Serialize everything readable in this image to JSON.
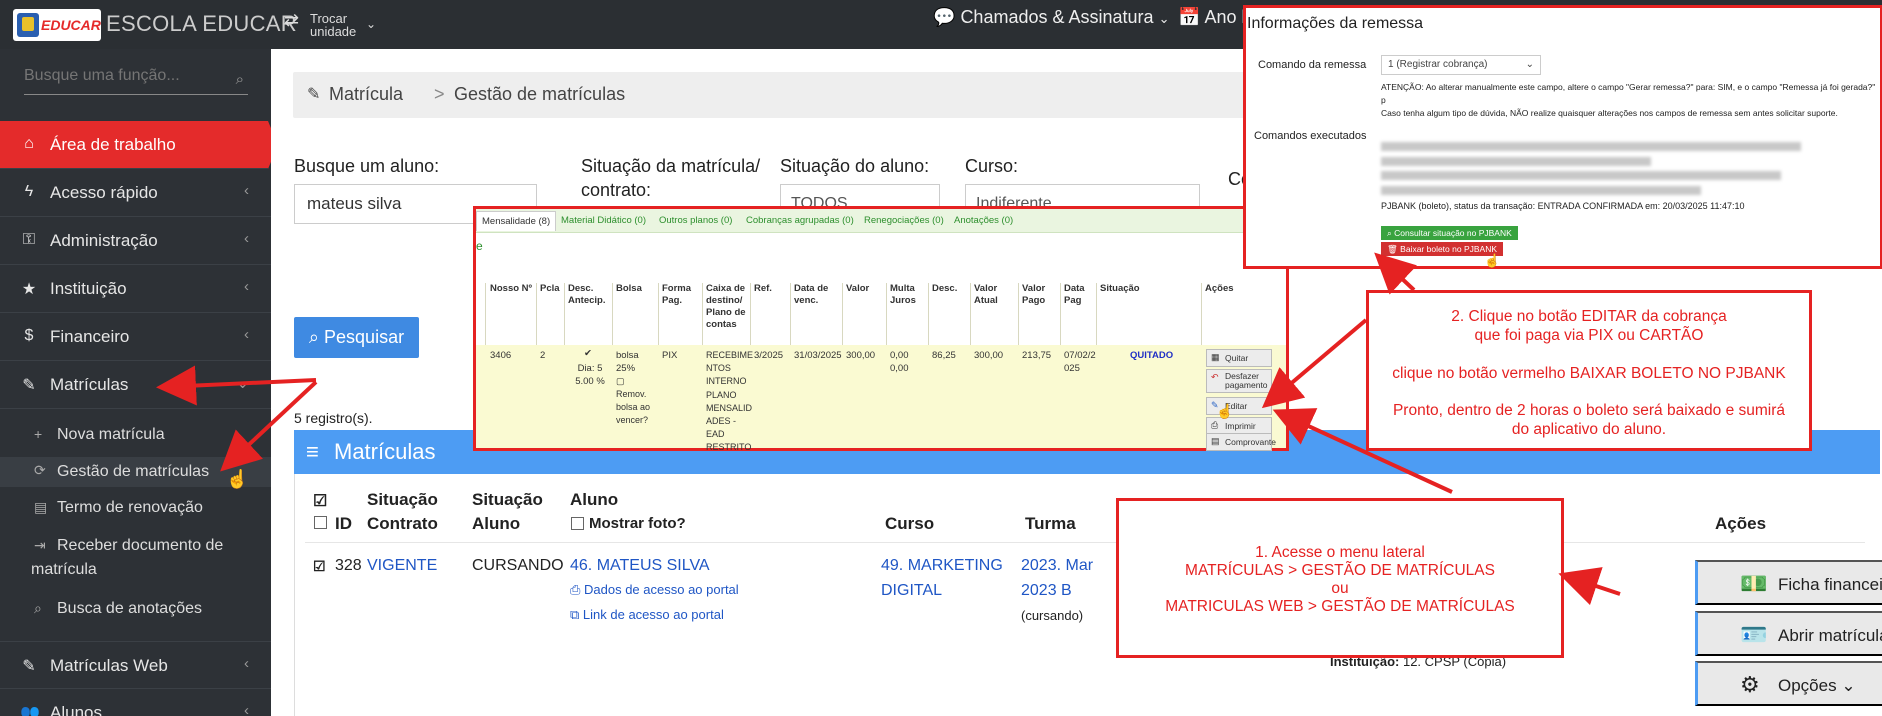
{
  "topbar": {
    "logo_text": "EDUCAR",
    "brand": "ESCOLA EDUCAR",
    "switch_line1": "Trocar",
    "switch_line2": "unidade",
    "tickets": "Chamados & Assinatura",
    "year": "Ano l"
  },
  "sidebar": {
    "search_placeholder": "Busque uma função...",
    "items": [
      {
        "label": "Área de trabalho"
      },
      {
        "label": "Acesso rápido"
      },
      {
        "label": "Administração"
      },
      {
        "label": "Instituição"
      },
      {
        "label": "Financeiro"
      },
      {
        "label": "Matrículas"
      }
    ],
    "sub_items": [
      {
        "label": "Nova matrícula"
      },
      {
        "label": "Gestão de matrículas"
      },
      {
        "label": "Termo de renovação"
      },
      {
        "label": "Receber documento de matrícula"
      },
      {
        "label": "Busca de anotações"
      }
    ],
    "items_bottom": [
      {
        "label": "Matrículas Web"
      },
      {
        "label": "Alunos"
      }
    ]
  },
  "main": {
    "breadcrumb": {
      "root": "Matrícula",
      "sep": ">",
      "current": "Gestão de matrículas"
    },
    "filters": {
      "student_label": "Busque um aluno:",
      "student_value": "mateus silva",
      "enroll_status_label": "Situação da matrícula/ contrato:",
      "student_status_label": "Situação do aluno:",
      "student_status_value": "TODOS",
      "course_label": "Curso:",
      "course_value": "Indiferente",
      "extra_label": "Co"
    },
    "search_button": "Pesquisar",
    "records": "5 registro(s).",
    "panel_title": "Matrículas",
    "table": {
      "headers": {
        "id": "ID",
        "contract": "Situação Contrato",
        "student_status": "Situação Aluno",
        "student": "Aluno",
        "show_photo": "Mostrar foto?",
        "course": "Curso",
        "class": "Turma",
        "actions": "Ações"
      },
      "row": {
        "id": "328",
        "contract": "VIGENTE",
        "student_status": "CURSANDO",
        "student": "46. MATEUS SILVA",
        "portal_access": "Dados de acesso ao portal",
        "portal_link": "Link de acesso ao portal",
        "course_line1": "49. MARKETING",
        "course_line2": "DIGITAL",
        "class_line1": "2023. Mar",
        "class_line2": "2023 B",
        "class_line3": "(cursando)",
        "institution_label": "Instituição:",
        "institution_value": "12. CPSP (Cópia)"
      },
      "actions": [
        "Ficha financeira",
        "Abrir matrícula",
        "Opções"
      ]
    }
  },
  "charges_overlay": {
    "tabs": [
      "Mensalidade (8)",
      "Material Didático (0)",
      "Outros planos (0)",
      "Cobranças agrupadas (0)",
      "Renegociações (0)",
      "Anotações (0)"
    ],
    "side_letter": "e",
    "headers": [
      "Nosso Nº",
      "Pcla",
      "Desc. Antecip.",
      "Bolsa",
      "Forma Pag.",
      "Caixa de destino/ Plano de contas",
      "Ref.",
      "Data de venc.",
      "Valor",
      "Multa Juros",
      "Desc.",
      "Valor Atual",
      "Valor Pago",
      "Data Pag",
      "Situação",
      "Ações"
    ],
    "row": {
      "nosso": "3406",
      "pcla": "2",
      "desc_antecip": "Dia: 5 5.00 %",
      "bolsa": "bolsa 25%",
      "bolsa_remove": "Remov. bolsa ao vencer?",
      "forma": "PIX",
      "caixa1": "RECEBIME NTOS INTERNO",
      "caixa2": "PLANO MENSALID ADES - EAD RESTRITO",
      "ref": "3/2025",
      "venc": "31/03/2025",
      "valor": "300,00",
      "multa1": "0,00",
      "multa2": "0,00",
      "desc": "86,25",
      "atual": "300,00",
      "pago": "213,75",
      "datapag": "07/02/2 025",
      "situacao": "QUITADO"
    },
    "actions": [
      "Quitar",
      "Desfazer pagamento",
      "Editar",
      "Imprimir",
      "Comprovante"
    ]
  },
  "remit_overlay": {
    "title": "Informações da remessa",
    "command_label": "Comando da remessa",
    "command_value": "1 (Registrar cobrança)",
    "note_line1": "ATENÇÃO: Ao alterar manualmente este campo, altere o campo \"Gerar remessa?\" para: SIM, e o campo \"Remessa já foi gerada?\" p",
    "note_line2": "Caso tenha algum tipo de dúvida, NÃO realize quaisquer alterações nos campos de remessa sem antes solicitar suporte.",
    "executed_label": "Comandos executados",
    "executed_visible": "PJBANK (boleto), status da transação: ENTRADA CONFIRMADA em: 20/03/2025 11:47:10",
    "btn_consult": "Consultar situação no PJBANK",
    "btn_cancel": "Baixar boleto no PJBANK"
  },
  "callouts": {
    "step2_l1": "2. Clique no botão EDITAR da cobrança",
    "step2_l2": "que foi paga via PIX ou CARTÃO",
    "step2_l3": "clique no botão vermelho BAIXAR BOLETO NO PJBANK",
    "step2_l4": "Pronto, dentro de 2 horas o boleto será baixado e sumirá",
    "step2_l5": "do aplicativo do aluno.",
    "step1_l1": "1. Acesse o menu lateral",
    "step1_l2": "MATRÍCULAS > GESTÃO DE MATRÍCULAS",
    "step1_l3": "ou",
    "step1_l4": "MATRICULAS WEB > GESTÃO DE MATRÍCULAS"
  },
  "colors": {
    "accent_red": "#e42b2b",
    "panel_blue": "#4d9cf3",
    "link_blue": "#1f56c5",
    "callout_red": "#e52222"
  }
}
